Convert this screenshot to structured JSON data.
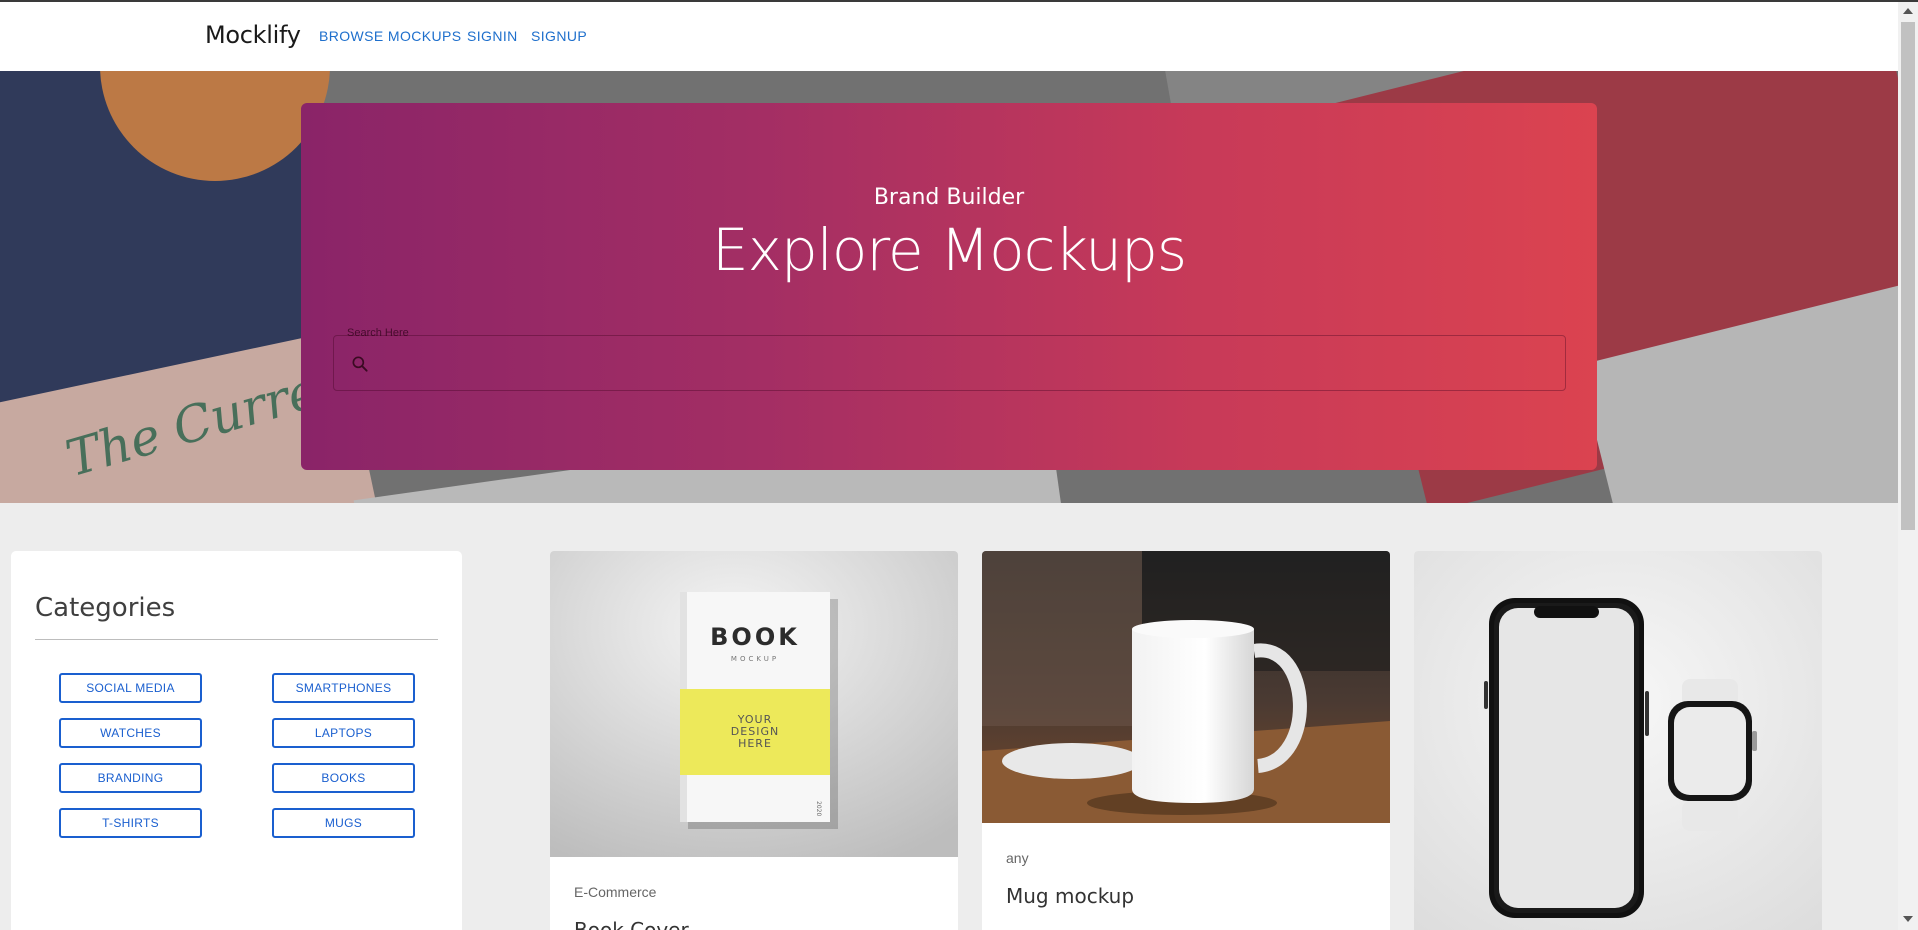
{
  "nav": {
    "brand": "Mocklify",
    "links": [
      "BROWSE MOCKUPS",
      "SIGNIN",
      "SIGNUP"
    ]
  },
  "hero": {
    "subtitle": "Brand Builder",
    "title": "Explore Mockups",
    "search_label": "Search Here",
    "search_value": "",
    "background_text": "The Curren"
  },
  "categories": {
    "title": "Categories",
    "items": [
      "SOCIAL MEDIA",
      "SMARTPHONES",
      "WATCHES",
      "LAPTOPS",
      "BRANDING",
      "BOOKS",
      "T-SHIRTS",
      "MUGS"
    ]
  },
  "cards": [
    {
      "category": "E-Commerce",
      "title": "Book Cover",
      "image": {
        "heading": "BOOK",
        "subheading": "MOCKUP",
        "line1": "YOUR",
        "line2": "DESIGN",
        "line3": "HERE",
        "spine": "2020"
      }
    },
    {
      "category": "any",
      "title": "Mug mockup"
    },
    {
      "category": "",
      "title": ""
    }
  ],
  "colors": {
    "accent": "#1a5fcf",
    "hero_gradient_start": "#8a2468",
    "hero_gradient_end": "#db4350"
  }
}
